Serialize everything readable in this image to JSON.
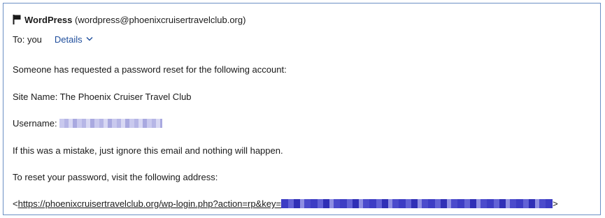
{
  "email": {
    "sender_name": "WordPress",
    "sender_address": "(wordpress@phoenixcruisertravelclub.org)",
    "to_label": "To: you",
    "details_label": "Details",
    "body": {
      "line1": "Someone has requested a password reset for the following account:",
      "line2": "Site Name: The Phoenix Cruiser Travel Club",
      "username_label": "Username:",
      "line4": "If this was a mistake, just ignore this email and nothing will happen.",
      "line5": "To reset your password, visit the following address:",
      "link_open": "<",
      "link_text": "https://phoenixcruisertravelclub.org/wp-login.php?action=rp&key=",
      "link_close": ">"
    }
  },
  "icons": {
    "flag": "flag-icon",
    "chevron": "chevron-down-icon"
  },
  "colors": {
    "frame_border": "#6b8fc4",
    "details_link": "#1f4e9c",
    "redaction_light": "#c9c9ee",
    "redaction_dark": "#3d3dc4"
  }
}
